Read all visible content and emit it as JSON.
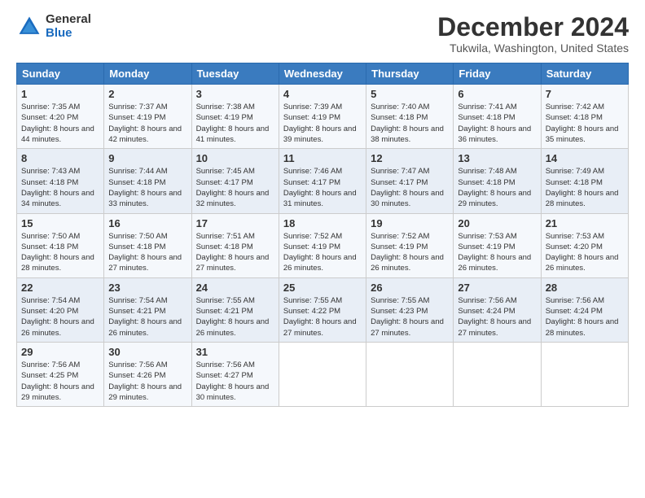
{
  "logo": {
    "general": "General",
    "blue": "Blue"
  },
  "title": "December 2024",
  "location": "Tukwila, Washington, United States",
  "headers": [
    "Sunday",
    "Monday",
    "Tuesday",
    "Wednesday",
    "Thursday",
    "Friday",
    "Saturday"
  ],
  "weeks": [
    [
      {
        "day": "1",
        "sunrise": "7:35 AM",
        "sunset": "4:20 PM",
        "daylight": "8 hours and 44 minutes."
      },
      {
        "day": "2",
        "sunrise": "7:37 AM",
        "sunset": "4:19 PM",
        "daylight": "8 hours and 42 minutes."
      },
      {
        "day": "3",
        "sunrise": "7:38 AM",
        "sunset": "4:19 PM",
        "daylight": "8 hours and 41 minutes."
      },
      {
        "day": "4",
        "sunrise": "7:39 AM",
        "sunset": "4:19 PM",
        "daylight": "8 hours and 39 minutes."
      },
      {
        "day": "5",
        "sunrise": "7:40 AM",
        "sunset": "4:18 PM",
        "daylight": "8 hours and 38 minutes."
      },
      {
        "day": "6",
        "sunrise": "7:41 AM",
        "sunset": "4:18 PM",
        "daylight": "8 hours and 36 minutes."
      },
      {
        "day": "7",
        "sunrise": "7:42 AM",
        "sunset": "4:18 PM",
        "daylight": "8 hours and 35 minutes."
      }
    ],
    [
      {
        "day": "8",
        "sunrise": "7:43 AM",
        "sunset": "4:18 PM",
        "daylight": "8 hours and 34 minutes."
      },
      {
        "day": "9",
        "sunrise": "7:44 AM",
        "sunset": "4:18 PM",
        "daylight": "8 hours and 33 minutes."
      },
      {
        "day": "10",
        "sunrise": "7:45 AM",
        "sunset": "4:17 PM",
        "daylight": "8 hours and 32 minutes."
      },
      {
        "day": "11",
        "sunrise": "7:46 AM",
        "sunset": "4:17 PM",
        "daylight": "8 hours and 31 minutes."
      },
      {
        "day": "12",
        "sunrise": "7:47 AM",
        "sunset": "4:17 PM",
        "daylight": "8 hours and 30 minutes."
      },
      {
        "day": "13",
        "sunrise": "7:48 AM",
        "sunset": "4:18 PM",
        "daylight": "8 hours and 29 minutes."
      },
      {
        "day": "14",
        "sunrise": "7:49 AM",
        "sunset": "4:18 PM",
        "daylight": "8 hours and 28 minutes."
      }
    ],
    [
      {
        "day": "15",
        "sunrise": "7:50 AM",
        "sunset": "4:18 PM",
        "daylight": "8 hours and 28 minutes."
      },
      {
        "day": "16",
        "sunrise": "7:50 AM",
        "sunset": "4:18 PM",
        "daylight": "8 hours and 27 minutes."
      },
      {
        "day": "17",
        "sunrise": "7:51 AM",
        "sunset": "4:18 PM",
        "daylight": "8 hours and 27 minutes."
      },
      {
        "day": "18",
        "sunrise": "7:52 AM",
        "sunset": "4:19 PM",
        "daylight": "8 hours and 26 minutes."
      },
      {
        "day": "19",
        "sunrise": "7:52 AM",
        "sunset": "4:19 PM",
        "daylight": "8 hours and 26 minutes."
      },
      {
        "day": "20",
        "sunrise": "7:53 AM",
        "sunset": "4:19 PM",
        "daylight": "8 hours and 26 minutes."
      },
      {
        "day": "21",
        "sunrise": "7:53 AM",
        "sunset": "4:20 PM",
        "daylight": "8 hours and 26 minutes."
      }
    ],
    [
      {
        "day": "22",
        "sunrise": "7:54 AM",
        "sunset": "4:20 PM",
        "daylight": "8 hours and 26 minutes."
      },
      {
        "day": "23",
        "sunrise": "7:54 AM",
        "sunset": "4:21 PM",
        "daylight": "8 hours and 26 minutes."
      },
      {
        "day": "24",
        "sunrise": "7:55 AM",
        "sunset": "4:21 PM",
        "daylight": "8 hours and 26 minutes."
      },
      {
        "day": "25",
        "sunrise": "7:55 AM",
        "sunset": "4:22 PM",
        "daylight": "8 hours and 27 minutes."
      },
      {
        "day": "26",
        "sunrise": "7:55 AM",
        "sunset": "4:23 PM",
        "daylight": "8 hours and 27 minutes."
      },
      {
        "day": "27",
        "sunrise": "7:56 AM",
        "sunset": "4:24 PM",
        "daylight": "8 hours and 27 minutes."
      },
      {
        "day": "28",
        "sunrise": "7:56 AM",
        "sunset": "4:24 PM",
        "daylight": "8 hours and 28 minutes."
      }
    ],
    [
      {
        "day": "29",
        "sunrise": "7:56 AM",
        "sunset": "4:25 PM",
        "daylight": "8 hours and 29 minutes."
      },
      {
        "day": "30",
        "sunrise": "7:56 AM",
        "sunset": "4:26 PM",
        "daylight": "8 hours and 29 minutes."
      },
      {
        "day": "31",
        "sunrise": "7:56 AM",
        "sunset": "4:27 PM",
        "daylight": "8 hours and 30 minutes."
      },
      null,
      null,
      null,
      null
    ]
  ],
  "colors": {
    "header_bg": "#3a7bbf",
    "odd_row": "#f5f8fc",
    "even_row": "#e8eef6"
  }
}
